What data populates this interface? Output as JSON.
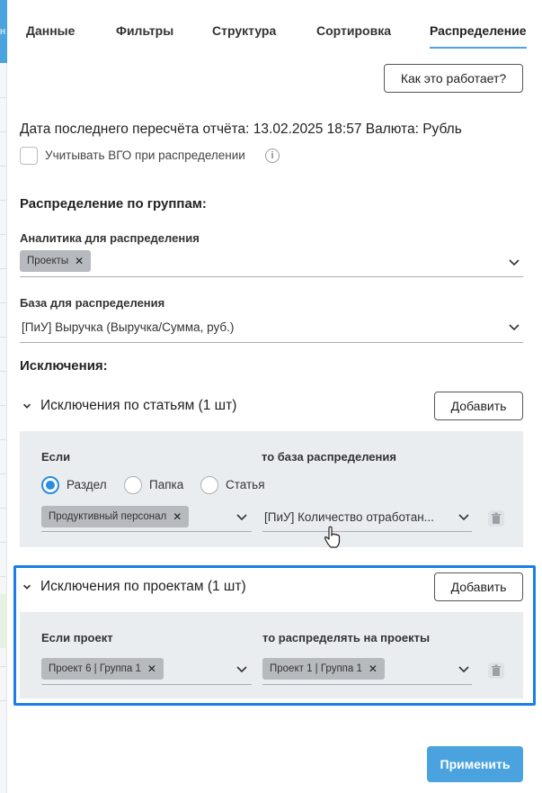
{
  "edge": {
    "tab_fragment": "н"
  },
  "tabs": [
    "Данные",
    "Фильтры",
    "Структура",
    "Сортировка",
    "Распределение"
  ],
  "how_it_works_button": "Как это работает?",
  "recalc_info": "Дата последнего пересчёта отчёта: 13.02.2025 18:57 Валюта: Рубль",
  "vgo_checkbox": {
    "label": "Учитывать ВГО при распределении",
    "checked": false
  },
  "group_distribution": {
    "heading": "Распределение по группам:",
    "analytics_label": "Аналитика для распределения",
    "analytics_chip": "Проекты",
    "base_label": "База для распределения",
    "base_value": "[ПиУ] Выручка (Выручка/Сумма, руб.)"
  },
  "exclusions_heading": "Исключения:",
  "article_exclusions": {
    "title": "Исключения по статьям (1 шт)",
    "add_button": "Добавить",
    "if_label": "Если",
    "then_label": "то база распределения",
    "radios": [
      {
        "label": "Раздел",
        "selected": true
      },
      {
        "label": "Папка",
        "selected": false
      },
      {
        "label": "Статья",
        "selected": false
      }
    ],
    "if_chip": "Продуктивный персонал",
    "then_value": "[ПиУ] Количество отработан..."
  },
  "project_exclusions": {
    "title": "Исключения по проектам (1 шт)",
    "add_button": "Добавить",
    "if_label": "Если проект",
    "then_label": "то распределять на проекты",
    "if_chip": "Проект 6 | Группа 1",
    "then_chip": "Проект 1 | Группа 1"
  },
  "apply_button": "Применить",
  "colors": {
    "accent": "#4aa3df",
    "highlight": "#1a7fe6",
    "panel": "#eaedf0"
  }
}
